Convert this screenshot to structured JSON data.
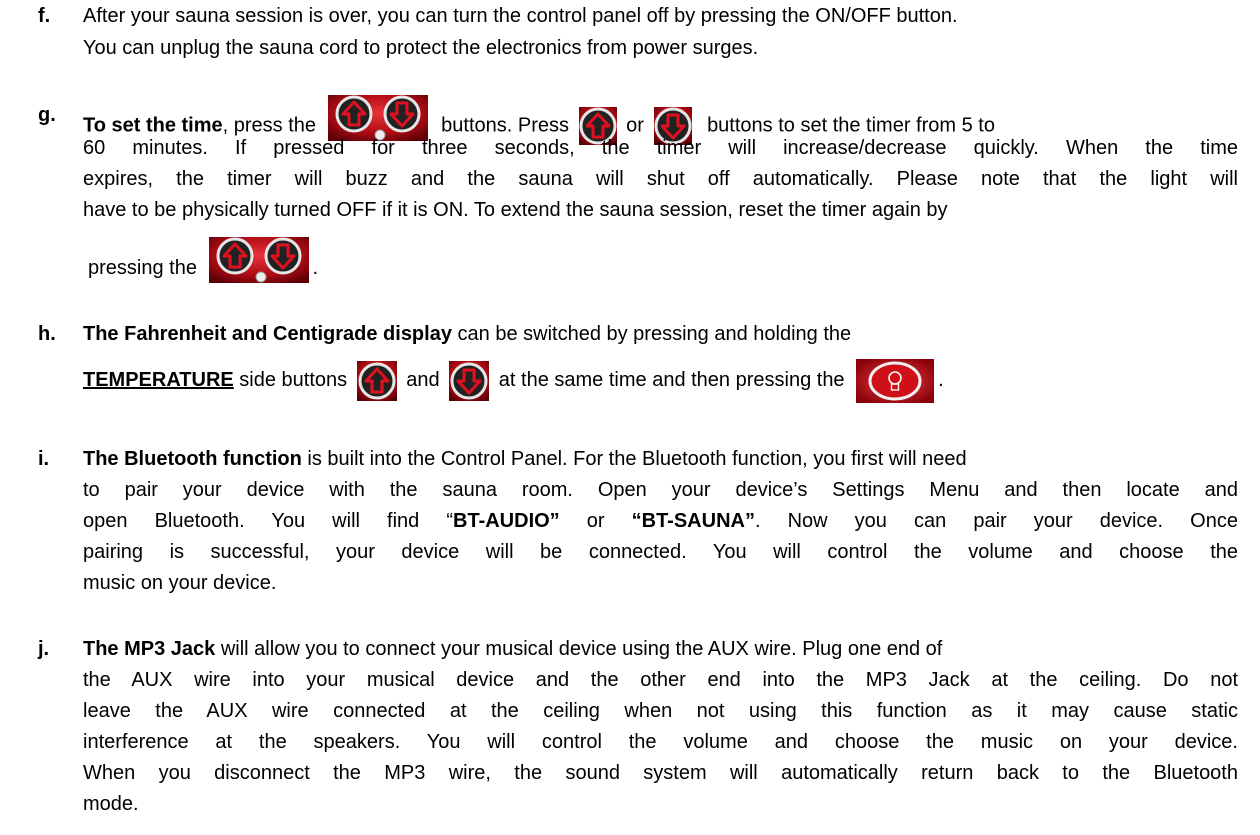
{
  "items": {
    "f": {
      "letter": "f.",
      "line1": "After your sauna session is over, you can turn the control panel off by pressing the ON/OFF button.",
      "line2": "You can unplug the sauna cord to protect the electronics from power surges."
    },
    "g": {
      "letter": "g.",
      "title": "To set the time",
      "t1": ", press the",
      "t2": "buttons. Press",
      "t3": "or",
      "t4": "buttons to set the timer from  5 to",
      "line2": "60 minutes. If pressed for three seconds, the timer will increase/decrease quickly.  When the time",
      "line3": "expires, the timer will buzz and the sauna will shut off automatically.  Please note that the light will",
      "line4": "have to be physically turned OFF if it is ON.  To extend the sauna session, reset the timer again by",
      "line5a": "pressing the",
      "line5b": "."
    },
    "h": {
      "letter": "h.",
      "title": "The Fahrenheit and Centigrade display",
      "t1": " can be switched by pressing and holding the",
      "temp_label": "TEMPERATURE",
      "t2": " side buttons",
      "t3": "and",
      "t4": "at the same time and then pressing the",
      "t5": "."
    },
    "i": {
      "letter": "i.",
      "title": "The Bluetooth function",
      "t1": " is built into the Control Panel.  For the Bluetooth function, you first will need",
      "line2": "to pair your device with the sauna room. Open your device’s Settings Menu and then locate and",
      "line3a": "open Bluetooth. You will find “",
      "bt_audio": "BT-AUDIO”",
      "line3b": " or ",
      "bt_sauna": "“BT-SAUNA”",
      "line3c": ". Now you can pair your device. Once",
      "line4": "pairing is successful, your device will be connected.  You will control the volume and choose the",
      "line5": "music on your device."
    },
    "j": {
      "letter": "j.",
      "title": "The MP3 Jack",
      "t1": " will allow you to connect your musical device using the AUX wire.  Plug one end of",
      "line2": "the AUX wire into your musical device and the other end into the MP3 Jack at the ceiling.  Do not",
      "line3": "leave the AUX wire connected at the ceiling when not using this function as it may cause static",
      "line4": "interference at the speakers.  You will control the volume and choose the music on your device.",
      "line5": "When you disconnect the MP3 wire, the sound system will automatically return back to the Bluetooth",
      "line6": "mode."
    }
  },
  "icons": {
    "up": "arrow-up-button-icon",
    "down": "arrow-down-button-icon",
    "timer_panel": "timer-buttons-icon",
    "light": "light-button-icon"
  },
  "colors": {
    "button_red": "#c0101a",
    "arrow_red": "#e01020"
  }
}
